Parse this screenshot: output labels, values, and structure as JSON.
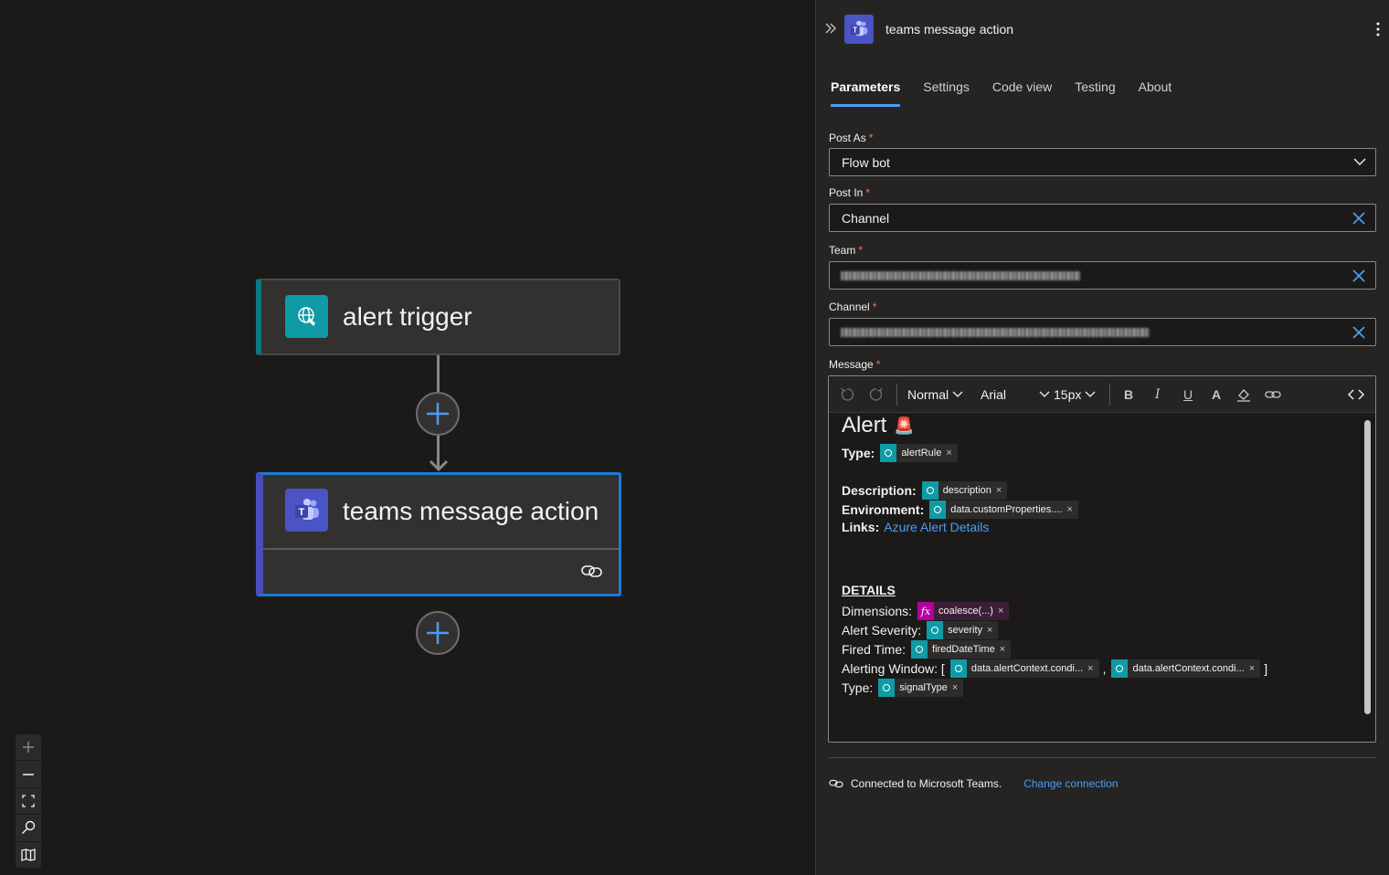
{
  "canvas": {
    "nodes": [
      {
        "title": "alert trigger"
      },
      {
        "title": "teams message action"
      }
    ],
    "zoom_controls": [
      "zoom-in-icon",
      "zoom-out-icon",
      "fit-view-icon",
      "search-icon",
      "minimap-icon"
    ]
  },
  "panel": {
    "title": "teams message action",
    "tabs": [
      "Parameters",
      "Settings",
      "Code view",
      "Testing",
      "About"
    ],
    "active_tab": "Parameters",
    "fields": {
      "post_as": {
        "label": "Post As",
        "value": "Flow bot"
      },
      "post_in": {
        "label": "Post In",
        "value": "Channel"
      },
      "team": {
        "label": "Team"
      },
      "channel": {
        "label": "Channel"
      },
      "message": {
        "label": "Message"
      }
    },
    "required_mark": "*",
    "toolbar": {
      "style": "Normal",
      "font": "Arial",
      "size": "15px"
    },
    "message": {
      "heading": "Alert",
      "heading_emoji": "🚨",
      "type_label": "Type:",
      "type_token": "alertRule",
      "description_label": "Description:",
      "description_token": "description",
      "environment_label": "Environment:",
      "environment_token": "data.customProperties....",
      "links_label": "Links:",
      "links_value": "Azure Alert Details",
      "details_heading": "DETAILS",
      "dimensions_label": "Dimensions:",
      "dimensions_token": "coalesce(...)",
      "severity_label": "Alert Severity:",
      "severity_token": "severity",
      "fired_label": "Fired Time:",
      "fired_token": "firedDateTime",
      "window_label": "Alerting Window: [",
      "window_token_1": "data.alertContext.condi...",
      "window_sep": ",",
      "window_token_2": "data.alertContext.condi...",
      "window_end": "]",
      "type2_label": "Type:",
      "type2_token": "signalType",
      "token_remove": "×"
    },
    "connection": {
      "text": "Connected to Microsoft Teams.",
      "change": "Change connection"
    }
  },
  "colors": {
    "accent": "#479ef5",
    "teams": "#4a54c4",
    "trigger": "#0f9ba6",
    "expression": "#b4009e",
    "selected_border": "#1d7ad8"
  }
}
